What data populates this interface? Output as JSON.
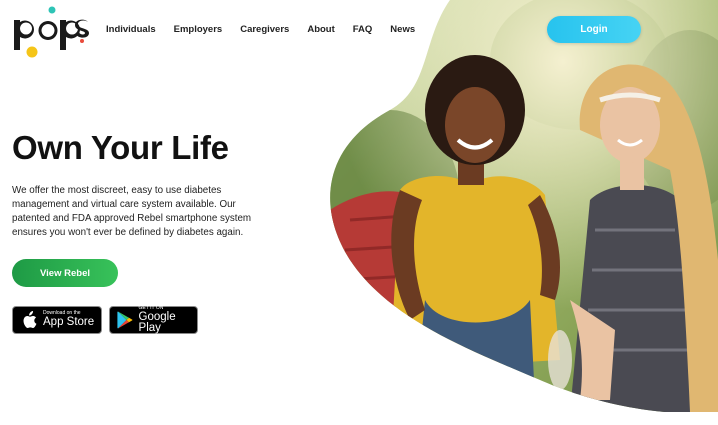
{
  "brand": {
    "logo_text": "pops"
  },
  "nav": {
    "items": [
      {
        "label": "Individuals"
      },
      {
        "label": "Employers"
      },
      {
        "label": "Caregivers"
      },
      {
        "label": "About"
      },
      {
        "label": "FAQ"
      },
      {
        "label": "News"
      }
    ],
    "login_label": "Login"
  },
  "hero": {
    "headline": "Own Your Life",
    "body": "We offer the most discreet, easy to use diabetes management and virtual care system available. Our patented and FDA approved Rebel smartphone system ensures you won't ever be defined by diabetes again.",
    "cta_label": "View Rebel",
    "image_alt": "Three young women smiling and dancing outdoors"
  },
  "stores": {
    "apple": {
      "small": "Download on the",
      "big": "App Store",
      "icon": "apple-icon"
    },
    "google": {
      "small": "GET IT ON",
      "big": "Google Play",
      "icon": "google-play-icon"
    }
  },
  "colors": {
    "login": "#27c3ee",
    "cta": "#2aa84b",
    "logo_yellow": "#f5c518",
    "logo_red": "#e94b3c",
    "logo_teal": "#2ec4b6"
  }
}
